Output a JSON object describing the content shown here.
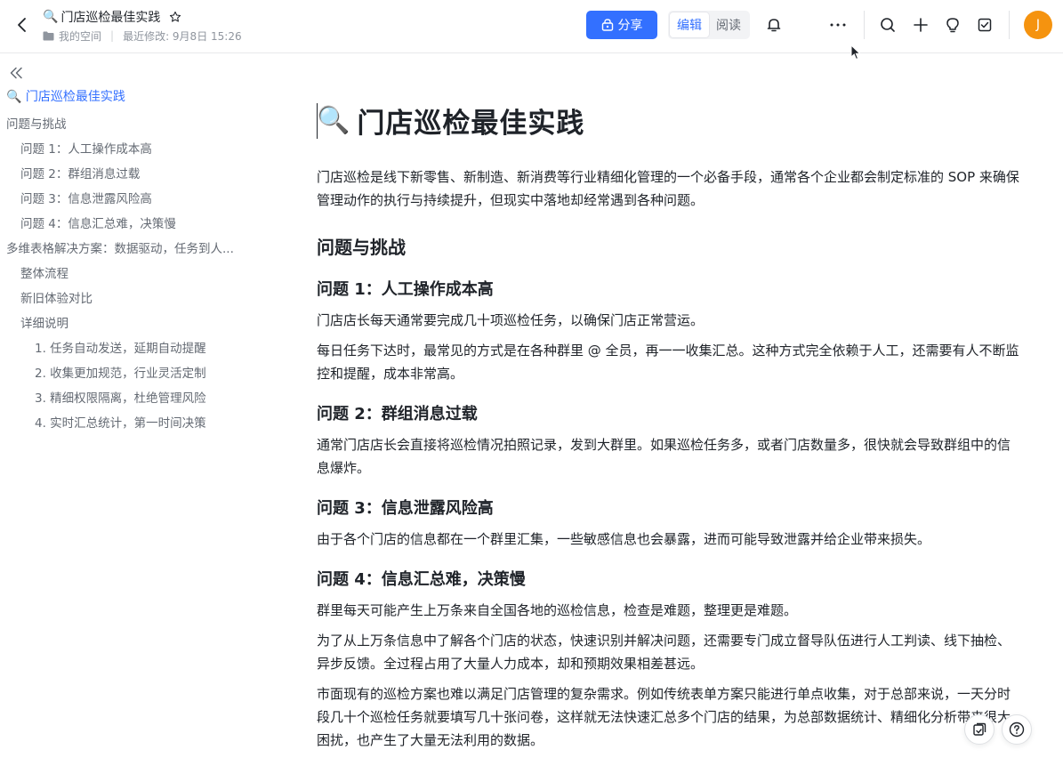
{
  "header": {
    "title_emoji": "🔍",
    "title": "门店巡检最佳实践",
    "location": "我的空间",
    "last_modified": "最近修改: 9月8日 15:26",
    "share_label": "分享",
    "mode_edit": "编辑",
    "mode_read": "阅读",
    "avatar_letter": "J",
    "avatar_color": "#f5930f",
    "accent_color": "#3370ff"
  },
  "outline": {
    "items": [
      {
        "label": "🔍 门店巡检最佳实践",
        "level": 0
      },
      {
        "label": "问题与挑战",
        "level": 1
      },
      {
        "label": "问题 1：人工操作成本高",
        "level": 2
      },
      {
        "label": "问题 2：群组消息过载",
        "level": 2
      },
      {
        "label": "问题 3：信息泄露风险高",
        "level": 2
      },
      {
        "label": "问题 4：信息汇总难，决策慢",
        "level": 2
      },
      {
        "label": "多维表格解决方案：数据驱动，任务到人...",
        "level": 1
      },
      {
        "label": "整体流程",
        "level": 2
      },
      {
        "label": "新旧体验对比",
        "level": 2
      },
      {
        "label": "详细说明",
        "level": 2
      },
      {
        "label": "1. 任务自动发送，延期自动提醒",
        "level": 3
      },
      {
        "label": "2. 收集更加规范，行业灵活定制",
        "level": 3
      },
      {
        "label": "3. 精细权限隔离，杜绝管理风险",
        "level": 3
      },
      {
        "label": "4. 实时汇总统计，第一时间决策",
        "level": 3
      }
    ]
  },
  "doc": {
    "title_emoji": "🔍",
    "title": "门店巡检最佳实践",
    "intro": "门店巡检是线下新零售、新制造、新消费等行业精细化管理的一个必备手段，通常各个企业都会制定标准的 SOP 来确保管理动作的执行与持续提升，但现实中落地却经常遇到各种问题。",
    "section_title": "问题与挑战",
    "p1_title": "问题 1：人工操作成本高",
    "p1_a": "门店店长每天通常要完成几十项巡检任务，以确保门店正常营运。",
    "p1_b": "每日任务下达时，最常见的方式是在各种群里 @ 全员，再一一收集汇总。这种方式完全依赖于人工，还需要有人不断监控和提醒，成本非常高。",
    "p2_title": "问题 2：群组消息过载",
    "p2_a": "通常门店店长会直接将巡检情况拍照记录，发到大群里。如果巡检任务多，或者门店数量多，很快就会导致群组中的信息爆炸。",
    "p3_title": "问题 3：信息泄露风险高",
    "p3_a": "由于各个门店的信息都在一个群里汇集，一些敏感信息也会暴露，进而可能导致泄露并给企业带来损失。",
    "p4_title": "问题 4：信息汇总难，决策慢",
    "p4_a": "群里每天可能产生上万条来自全国各地的巡检信息，检查是难题，整理更是难题。",
    "p4_b": "为了从上万条信息中了解各个门店的状态，快速识别并解决问题，还需要专门成立督导队伍进行人工判读、线下抽检、异步反馈。全过程占用了大量人力成本，却和预期效果相差甚远。",
    "p4_c": "市面现有的巡检方案也难以满足门店管理的复杂需求。例如传统表单方案只能进行单点收集，对于总部来说，一天分时段几十个巡检任务就要填写几十张问卷，这样就无法快速汇总多个门店的结果，为总部数据统计、精细化分析带来很大困扰，也产生了大量无法利用的数据。"
  }
}
